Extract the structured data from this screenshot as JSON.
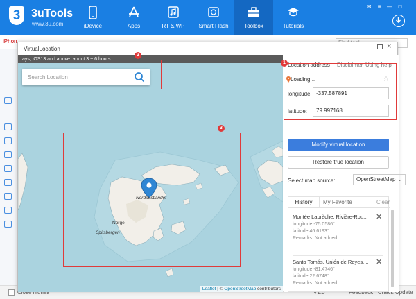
{
  "app": {
    "name": "3uTools",
    "url": "www.3u.com",
    "logo_glyph": "3",
    "nav": [
      {
        "label": "iDevice",
        "icon": "phone-icon"
      },
      {
        "label": "Apps",
        "icon": "app-store-icon"
      },
      {
        "label": "RT & WP",
        "icon": "music-icon"
      },
      {
        "label": "Smart Flash",
        "icon": "flash-icon"
      },
      {
        "label": "Toolbox",
        "icon": "toolbox-icon",
        "active": true
      },
      {
        "label": "Tutorials",
        "icon": "graduation-cap-icon"
      }
    ],
    "window_controls": [
      "✉",
      "≡",
      "—",
      "□",
      "✕"
    ],
    "accent_color": "#1a7fe3"
  },
  "background": {
    "device_tab": "iPhon",
    "find_tool_placeholder": "Find tool",
    "footer": {
      "close_itunes": "Close iTunes",
      "links": [
        "V1.0",
        "Feedback",
        "Check Update"
      ]
    }
  },
  "dialog": {
    "title": "VirtualLocation",
    "notice": "ays; iOS13 and above: about 3 ~ 6 hours",
    "search_placeholder": "Search Location",
    "map": {
      "labels": {
        "nordaustlandet": "Nordaustlandet",
        "norge": "Norge",
        "spitsbergen": "Spitsbergen"
      },
      "attribution": {
        "leaflet": "Leaflet",
        "sep": " | © ",
        "osm": "OpenStreetMap",
        "suffix": " contributors"
      },
      "water_color": "#aad3df",
      "land_color": "#f2efe9"
    },
    "annotations": [
      "1",
      "2",
      "3"
    ],
    "panel": {
      "tabs": [
        "Location address",
        "Disclaimer",
        "Using help"
      ],
      "status": "Loading...",
      "longitude_label": "longitude:",
      "longitude_value": "-337.587891",
      "latitude_label": "latitude:",
      "latitude_value": "79.997168",
      "modify_button": "Modify virtual location",
      "restore_button": "Restore true location",
      "map_source_label": "Select map source:",
      "map_source_value": "OpenStreetMap",
      "history_tab": "History",
      "favorite_tab": "My Favorite",
      "clear_label": "Clear",
      "history": [
        {
          "title": "Montée Labrèche, Rivière-Rou...",
          "longitude": "longitude -75.0586°",
          "latitude": "latitude 46.6193°",
          "remarks": "Remarks: Not added"
        },
        {
          "title": "Santo Tomás, Unión de Reyes, ...",
          "longitude": "longitude -81.4746°",
          "latitude": "latitude 22.6748°",
          "remarks": "Remarks: Not added"
        }
      ]
    }
  }
}
